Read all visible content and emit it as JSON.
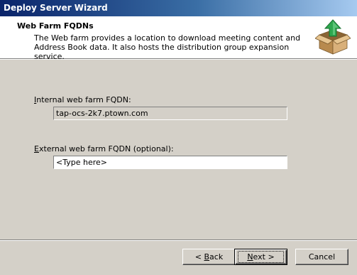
{
  "window": {
    "title": "Deploy Server Wizard"
  },
  "header": {
    "title": "Web Farm FQDNs",
    "description": "The Web farm provides a location to download meeting content and Address Book data. It also hosts the distribution group expansion service.",
    "icon": "package-upload-icon"
  },
  "fields": {
    "internal": {
      "label_prefix": "I",
      "label_rest": "nternal web farm FQDN:",
      "value": "tap-ocs-2k7.ptown.com"
    },
    "external": {
      "label_prefix": "E",
      "label_rest": "xternal web farm FQDN (optional):",
      "value": "<Type here>"
    }
  },
  "buttons": {
    "back_prefix": "< ",
    "back_accel": "B",
    "back_rest": "ack",
    "next_prefix": "",
    "next_accel": "N",
    "next_rest": "ext >",
    "cancel": "Cancel"
  },
  "colors": {
    "dialog_bg": "#d4d0c8",
    "title_gradient_start": "#0a246a",
    "title_gradient_end": "#a6caf0",
    "header_bg": "#ffffff",
    "icon_arrow": "#2fa84f",
    "icon_box": "#c9a064"
  }
}
